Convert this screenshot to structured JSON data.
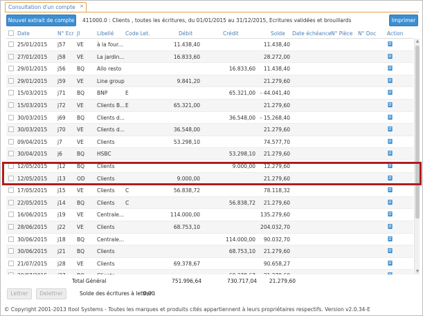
{
  "tab": {
    "title": "Consultation d'un compte",
    "close": "×"
  },
  "toolbar": {
    "new_label": "Nouvel extrait de compte",
    "description": "411000.0 : Clients , toutes les écritures, du 01/01/2015 au 31/12/2015, Ecritures validées et brouillards",
    "print_label": "Imprimer"
  },
  "columns": {
    "date": "Date",
    "ecr": "N° Ecr",
    "jl": "Jl",
    "libelle": "Libellé",
    "code_let": "Code Let.",
    "debit": "Débit",
    "credit": "Crédit",
    "solde": "Solde",
    "echeance": "Date échéance",
    "piece": "N° Pièce",
    "doc": "N° Doc",
    "action": "Action"
  },
  "rows": [
    {
      "date": "25/01/2015",
      "ecr": "j57",
      "jl": "VE",
      "libelle": "à la four...",
      "code": "",
      "debit": "11.438,40",
      "credit": "",
      "solde": "11.438,40"
    },
    {
      "date": "27/01/2015",
      "ecr": "j58",
      "jl": "VE",
      "libelle": "La jardin...",
      "code": "",
      "debit": "16.833,60",
      "credit": "",
      "solde": "28.272,00"
    },
    {
      "date": "29/01/2015",
      "ecr": "j56",
      "jl": "BQ",
      "libelle": "Allo resto",
      "code": "",
      "debit": "",
      "credit": "16.833,60",
      "solde": "11.438,40"
    },
    {
      "date": "29/01/2015",
      "ecr": "j59",
      "jl": "VE",
      "libelle": "Line group",
      "code": "",
      "debit": "9.841,20",
      "credit": "",
      "solde": "21.279,60"
    },
    {
      "date": "15/03/2015",
      "ecr": "j71",
      "jl": "BQ",
      "libelle": "BNP",
      "code": "E",
      "debit": "",
      "credit": "65.321,00",
      "solde": "- 44.041,40"
    },
    {
      "date": "15/03/2015",
      "ecr": "j72",
      "jl": "VE",
      "libelle": "Clients B...",
      "code": "E",
      "debit": "65.321,00",
      "credit": "",
      "solde": "21.279,60"
    },
    {
      "date": "30/03/2015",
      "ecr": "j69",
      "jl": "BQ",
      "libelle": "Clients d...",
      "code": "",
      "debit": "",
      "credit": "36.548,00",
      "solde": "- 15.268,40"
    },
    {
      "date": "30/03/2015",
      "ecr": "j70",
      "jl": "VE",
      "libelle": "Clients d...",
      "code": "",
      "debit": "36.548,00",
      "credit": "",
      "solde": "21.279,60"
    },
    {
      "date": "09/04/2015",
      "ecr": "j7",
      "jl": "VE",
      "libelle": "Clients",
      "code": "",
      "debit": "53.298,10",
      "credit": "",
      "solde": "74.577,70"
    },
    {
      "date": "30/04/2015",
      "ecr": "j6",
      "jl": "BQ",
      "libelle": "HSBC",
      "code": "",
      "debit": "",
      "credit": "53.298,10",
      "solde": "21.279,60"
    },
    {
      "date": "12/05/2015",
      "ecr": "j12",
      "jl": "BQ",
      "libelle": "Clients",
      "code": "",
      "debit": "",
      "credit": "9.000,00",
      "solde": "12.279,60"
    },
    {
      "date": "12/05/2015",
      "ecr": "j13",
      "jl": "OD",
      "libelle": "Clients",
      "code": "",
      "debit": "9.000,00",
      "credit": "",
      "solde": "21.279,60"
    },
    {
      "date": "17/05/2015",
      "ecr": "j15",
      "jl": "VE",
      "libelle": "Clients",
      "code": "C",
      "debit": "56.838,72",
      "credit": "",
      "solde": "78.118,32"
    },
    {
      "date": "22/05/2015",
      "ecr": "j14",
      "jl": "BQ",
      "libelle": "Clients",
      "code": "C",
      "debit": "",
      "credit": "56.838,72",
      "solde": "21.279,60"
    },
    {
      "date": "16/06/2015",
      "ecr": "j19",
      "jl": "VE",
      "libelle": "Centrale...",
      "code": "",
      "debit": "114.000,00",
      "credit": "",
      "solde": "135.279,60"
    },
    {
      "date": "28/06/2015",
      "ecr": "j22",
      "jl": "VE",
      "libelle": "Clients",
      "code": "",
      "debit": "68.753,10",
      "credit": "",
      "solde": "204.032,70"
    },
    {
      "date": "30/06/2015",
      "ecr": "j18",
      "jl": "BQ",
      "libelle": "Centrale...",
      "code": "",
      "debit": "",
      "credit": "114.000,00",
      "solde": "90.032,70"
    },
    {
      "date": "30/06/2015",
      "ecr": "j21",
      "jl": "BQ",
      "libelle": "Clients",
      "code": "",
      "debit": "",
      "credit": "68.753,10",
      "solde": "21.279,60"
    },
    {
      "date": "21/07/2015",
      "ecr": "j28",
      "jl": "VE",
      "libelle": "Clients",
      "code": "",
      "debit": "69.378,67",
      "credit": "",
      "solde": "90.658,27"
    },
    {
      "date": "30/07/2015",
      "ecr": "j27",
      "jl": "BQ",
      "libelle": "Clients",
      "code": "",
      "debit": "",
      "credit": "69.378,67",
      "solde": "21.279,60"
    },
    {
      "date": "28/08/2015",
      "ecr": "j33",
      "jl": "VE",
      "libelle": "Clients",
      "code": "",
      "debit": "76.345,12",
      "credit": "",
      "solde": "97.624,72"
    },
    {
      "date": "31/08/2015",
      "ecr": "j32",
      "jl": "BQ",
      "libelle": "Clients",
      "code": "",
      "debit": "",
      "credit": "76.345,12",
      "solde": "21.279,60"
    },
    {
      "date": "09/09/2015",
      "ecr": "j43",
      "jl": "VE",
      "libelle": "Clients",
      "code": "",
      "debit": "74.368,37",
      "credit": "",
      "solde": "95.647,97"
    }
  ],
  "totals": {
    "label": "Total Général",
    "debit": "751.996,64",
    "credit": "730.717,04",
    "solde": "21.279,60"
  },
  "lettrage": {
    "lettrer": "Lettrer",
    "delettrer": "Delettrer",
    "solde_label": "Solde des écritures à lettrer :",
    "solde_value": "0,00"
  },
  "footer": "© Copyright 2001-2013 Itool Systems - Toutes les marques et produits cités appartiennent à leurs propriétaires respectifs. Version v2.0.34-E",
  "colors": {
    "accent": "#3d8ed0",
    "header_text": "#4a7fb8",
    "highlight": "#b01c1c",
    "tab_border": "#e8a04a"
  }
}
